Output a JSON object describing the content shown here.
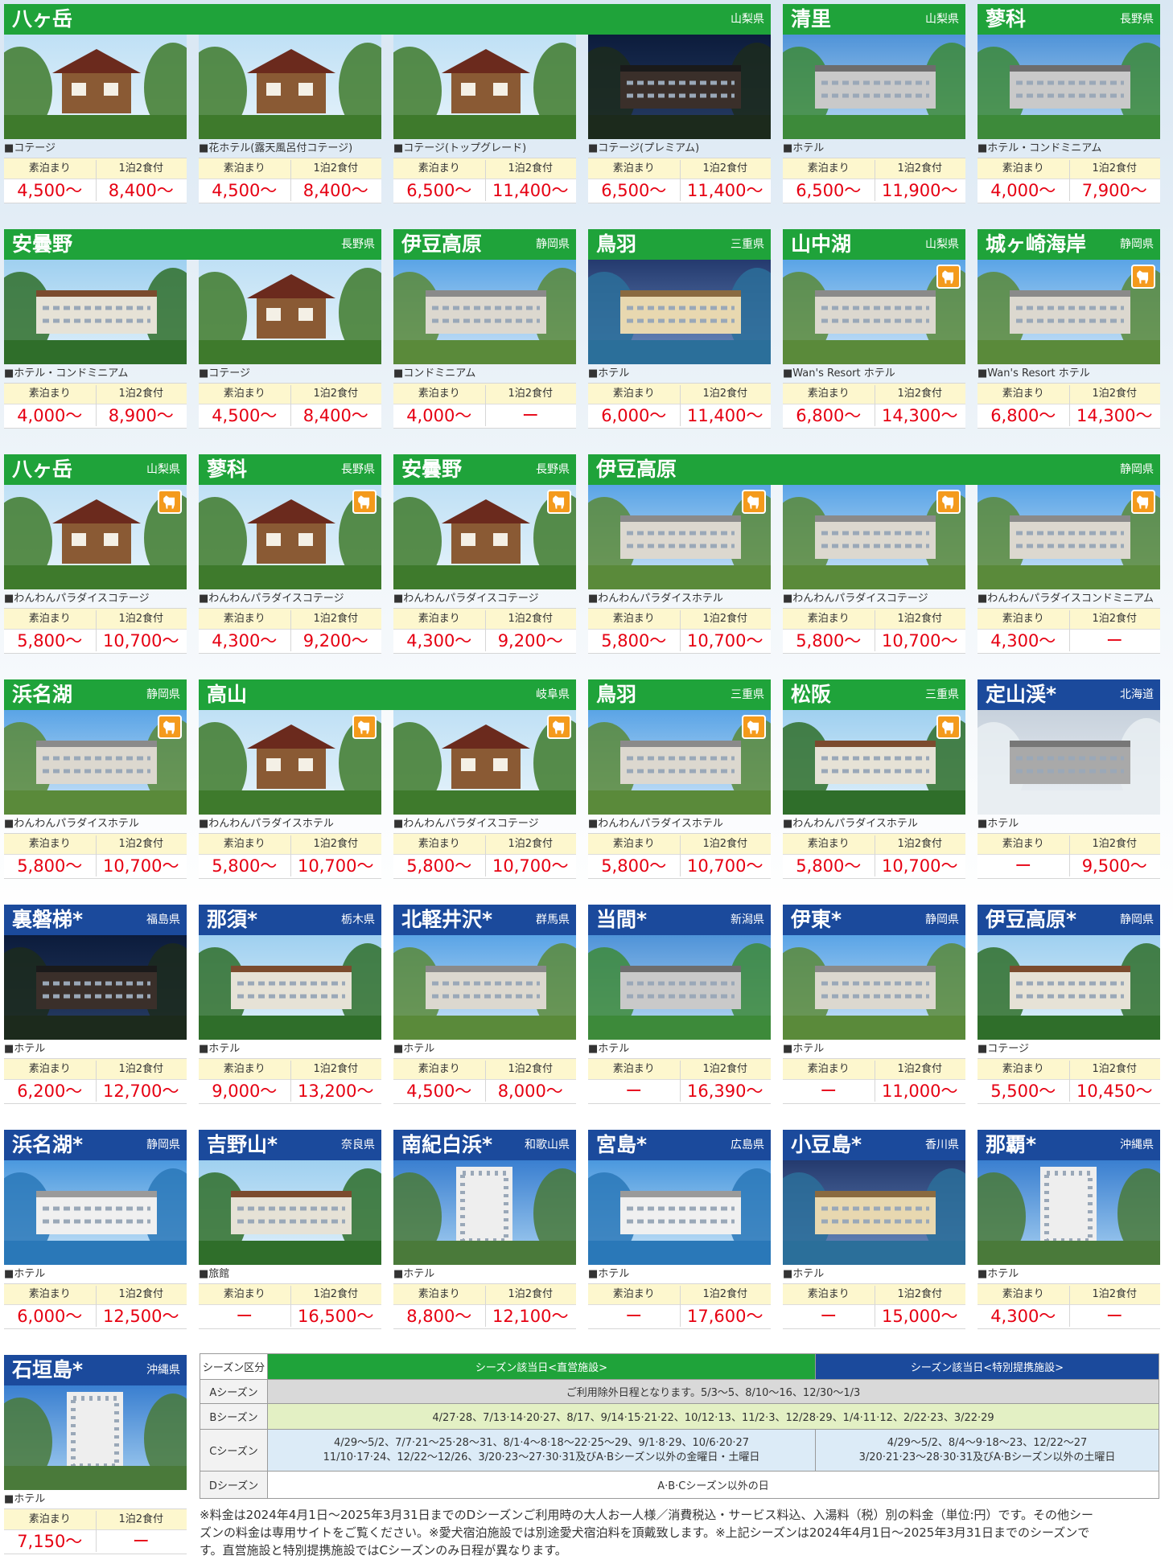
{
  "grid": {
    "price_labels": [
      "素泊まり",
      "1泊2食付"
    ],
    "rows": [
      {
        "headers": [
          {
            "name": "八ヶ岳",
            "pref": "山梨県",
            "span": 4,
            "color": "green"
          },
          {
            "name": "清里",
            "pref": "山梨県",
            "span": 1,
            "color": "green"
          },
          {
            "name": "蓼科",
            "pref": "長野県",
            "span": 1,
            "color": "green"
          }
        ],
        "cards": [
          {
            "type": "■コテージ",
            "stay": "4,500～",
            "meal": "8,400～",
            "dog": false,
            "scene": "cabin"
          },
          {
            "type": "■花ホテル(露天風呂付コテージ)",
            "stay": "4,500～",
            "meal": "8,400～",
            "dog": false,
            "scene": "cabin"
          },
          {
            "type": "■コテージ(トップグレード)",
            "stay": "6,500～",
            "meal": "11,400～",
            "dog": false,
            "scene": "cabin"
          },
          {
            "type": "■コテージ(プレミアム)",
            "stay": "6,500～",
            "meal": "11,400～",
            "dog": false,
            "scene": "night"
          },
          {
            "type": "■ホテル",
            "stay": "6,500～",
            "meal": "11,900～",
            "dog": false,
            "scene": "lake"
          },
          {
            "type": "■ホテル・コンドミニアム",
            "stay": "4,000～",
            "meal": "7,900～",
            "dog": false,
            "scene": "lake"
          }
        ]
      },
      {
        "headers": [
          {
            "name": "安曇野",
            "pref": "長野県",
            "span": 2,
            "color": "green"
          },
          {
            "name": "伊豆高原",
            "pref": "静岡県",
            "span": 1,
            "color": "green"
          },
          {
            "name": "鳥羽",
            "pref": "三重県",
            "span": 1,
            "color": "green"
          },
          {
            "name": "山中湖",
            "pref": "山梨県",
            "span": 1,
            "color": "green"
          },
          {
            "name": "城ヶ崎海岸",
            "pref": "静岡県",
            "span": 1,
            "color": "green"
          }
        ],
        "cards": [
          {
            "type": "■ホテル・コンドミニアム",
            "stay": "4,000～",
            "meal": "8,900～",
            "dog": false,
            "scene": "forest"
          },
          {
            "type": "■コテージ",
            "stay": "4,500～",
            "meal": "8,400～",
            "dog": false,
            "scene": "cabin"
          },
          {
            "type": "■コンドミニアム",
            "stay": "4,000～",
            "meal": "ー",
            "dog": false,
            "scene": "building"
          },
          {
            "type": "■ホテル",
            "stay": "6,000～",
            "meal": "11,400～",
            "dog": false,
            "scene": "pool"
          },
          {
            "type": "■Wan's Resort ホテル",
            "stay": "6,800～",
            "meal": "14,300～",
            "dog": true,
            "scene": "building"
          },
          {
            "type": "■Wan's Resort ホテル",
            "stay": "6,800～",
            "meal": "14,300～",
            "dog": true,
            "scene": "building"
          }
        ]
      },
      {
        "headers": [
          {
            "name": "八ヶ岳",
            "pref": "山梨県",
            "span": 1,
            "color": "green"
          },
          {
            "name": "蓼科",
            "pref": "長野県",
            "span": 1,
            "color": "green"
          },
          {
            "name": "安曇野",
            "pref": "長野県",
            "span": 1,
            "color": "green"
          },
          {
            "name": "伊豆高原",
            "pref": "静岡県",
            "span": 3,
            "color": "green"
          }
        ],
        "cards": [
          {
            "type": "■わんわんパラダイスコテージ",
            "stay": "5,800～",
            "meal": "10,700～",
            "dog": true,
            "scene": "cabin"
          },
          {
            "type": "■わんわんパラダイスコテージ",
            "stay": "4,300～",
            "meal": "9,200～",
            "dog": true,
            "scene": "cabin"
          },
          {
            "type": "■わんわんパラダイスコテージ",
            "stay": "4,300～",
            "meal": "9,200～",
            "dog": true,
            "scene": "cabin"
          },
          {
            "type": "■わんわんパラダイスホテル",
            "stay": "5,800～",
            "meal": "10,700～",
            "dog": true,
            "scene": "building"
          },
          {
            "type": "■わんわんパラダイスコテージ",
            "stay": "5,800～",
            "meal": "10,700～",
            "dog": true,
            "scene": "building"
          },
          {
            "type": "■わんわんパラダイスコンドミニアム",
            "stay": "4,300～",
            "meal": "ー",
            "dog": true,
            "scene": "building"
          }
        ]
      },
      {
        "headers": [
          {
            "name": "浜名湖",
            "pref": "静岡県",
            "span": 1,
            "color": "green"
          },
          {
            "name": "高山",
            "pref": "岐阜県",
            "span": 2,
            "color": "green"
          },
          {
            "name": "鳥羽",
            "pref": "三重県",
            "span": 1,
            "color": "green"
          },
          {
            "name": "松阪",
            "pref": "三重県",
            "span": 1,
            "color": "green"
          },
          {
            "name": "定山渓*",
            "pref": "北海道",
            "span": 1,
            "color": "blue"
          }
        ],
        "cards": [
          {
            "type": "■わんわんパラダイスホテル",
            "stay": "5,800～",
            "meal": "10,700～",
            "dog": true,
            "scene": "building"
          },
          {
            "type": "■わんわんパラダイスホテル",
            "stay": "5,800～",
            "meal": "10,700～",
            "dog": true,
            "scene": "cabin"
          },
          {
            "type": "■わんわんパラダイスコテージ",
            "stay": "5,800～",
            "meal": "10,700～",
            "dog": true,
            "scene": "cabin"
          },
          {
            "type": "■わんわんパラダイスホテル",
            "stay": "5,800～",
            "meal": "10,700～",
            "dog": true,
            "scene": "building"
          },
          {
            "type": "■わんわんパラダイスホテル",
            "stay": "5,800～",
            "meal": "10,700～",
            "dog": true,
            "scene": "forest"
          },
          {
            "type": "■ホテル",
            "stay": "ー",
            "meal": "9,500～",
            "dog": false,
            "scene": "snow"
          }
        ]
      },
      {
        "headers": [
          {
            "name": "裏磐梯*",
            "pref": "福島県",
            "span": 1,
            "color": "blue"
          },
          {
            "name": "那須*",
            "pref": "栃木県",
            "span": 1,
            "color": "blue"
          },
          {
            "name": "北軽井沢*",
            "pref": "群馬県",
            "span": 1,
            "color": "blue"
          },
          {
            "name": "当間*",
            "pref": "新潟県",
            "span": 1,
            "color": "blue"
          },
          {
            "name": "伊東*",
            "pref": "静岡県",
            "span": 1,
            "color": "blue"
          },
          {
            "name": "伊豆高原*",
            "pref": "静岡県",
            "span": 1,
            "color": "blue"
          }
        ],
        "cards": [
          {
            "type": "■ホテル",
            "stay": "6,200～",
            "meal": "12,700～",
            "dog": false,
            "scene": "night"
          },
          {
            "type": "■ホテル",
            "stay": "9,000～",
            "meal": "13,200～",
            "dog": false,
            "scene": "forest"
          },
          {
            "type": "■ホテル",
            "stay": "4,500～",
            "meal": "8,000～",
            "dog": false,
            "scene": "building"
          },
          {
            "type": "■ホテル",
            "stay": "ー",
            "meal": "16,390～",
            "dog": false,
            "scene": "lake"
          },
          {
            "type": "■ホテル",
            "stay": "ー",
            "meal": "11,000～",
            "dog": false,
            "scene": "building"
          },
          {
            "type": "■コテージ",
            "stay": "5,500～",
            "meal": "10,450～",
            "dog": false,
            "scene": "forest"
          }
        ]
      },
      {
        "headers": [
          {
            "name": "浜名湖*",
            "pref": "静岡県",
            "span": 1,
            "color": "blue"
          },
          {
            "name": "吉野山*",
            "pref": "奈良県",
            "span": 1,
            "color": "blue"
          },
          {
            "name": "南紀白浜*",
            "pref": "和歌山県",
            "span": 1,
            "color": "blue"
          },
          {
            "name": "宮島*",
            "pref": "広島県",
            "span": 1,
            "color": "blue"
          },
          {
            "name": "小豆島*",
            "pref": "香川県",
            "span": 1,
            "color": "blue"
          },
          {
            "name": "那覇*",
            "pref": "沖縄県",
            "span": 1,
            "color": "blue"
          }
        ],
        "cards": [
          {
            "type": "■ホテル",
            "stay": "6,000～",
            "meal": "12,500～",
            "dog": false,
            "scene": "sea"
          },
          {
            "type": "■旅館",
            "stay": "ー",
            "meal": "16,500～",
            "dog": false,
            "scene": "forest"
          },
          {
            "type": "■ホテル",
            "stay": "8,800～",
            "meal": "12,100～",
            "dog": false,
            "scene": "tower"
          },
          {
            "type": "■ホテル",
            "stay": "ー",
            "meal": "17,600～",
            "dog": false,
            "scene": "sea"
          },
          {
            "type": "■ホテル",
            "stay": "ー",
            "meal": "15,000～",
            "dog": false,
            "scene": "pool"
          },
          {
            "type": "■ホテル",
            "stay": "4,300～",
            "meal": "ー",
            "dog": false,
            "scene": "tower"
          }
        ]
      }
    ],
    "last": {
      "name": "石垣島*",
      "pref": "沖縄県",
      "type": "■ホテル",
      "stay": "7,150～",
      "meal": "ー",
      "scene": "tower",
      "color": "blue"
    }
  },
  "season_table": {
    "corner": "シーズン区分",
    "direct_header": "シーズン該当日<直営施設>",
    "partner_header": "シーズン該当日<特別提携施設>",
    "a": {
      "label": "Aシーズン",
      "text": "ご利用除外日程となります。5/3～5、8/10～16、12/30～1/3"
    },
    "b": {
      "label": "Bシーズン",
      "text": "4/27·28、7/13·14·20·27、8/17、9/14·15·21·22、10/12·13、11/2·3、12/28·29、1/4·11·12、2/22·23、3/22·29"
    },
    "c": {
      "label": "Cシーズン",
      "direct_1": "4/29～5/2、7/7·21～25·28～31、8/1·4～8·18～22·25～29、9/1·8·29、10/6·20·27",
      "direct_2": "11/10·17·24、12/22～12/26、3/20·23～27·30·31及びA·Bシーズン以外の金曜日・土曜日",
      "partner_1": "4/29～5/2、8/4～9·18～23、12/22～27",
      "partner_2": "3/20·21·23～28·30·31及びA·Bシーズン以外の土曜日"
    },
    "d": {
      "label": "Dシーズン",
      "text": "A·B·Cシーズン以外の日"
    }
  },
  "notes": {
    "line1": "※料金は2024年4月1日～2025年3月31日までのDシーズンご利用時の大人お一人様／消費税込・サービス料込、入湯料（税）別の料金（単位:円）です。その他シー",
    "line2": "ズンの料金は専用サイトをご覧ください。※愛犬宿泊施設では別途愛犬宿泊料を頂戴致します。※上記シーズンは2024年4月1日～2025年3月31日までのシーズンで",
    "line3": "す。直営施設と特別提携施設ではCシーズンのみ日程が異なります。"
  },
  "colors": {
    "green": "#1fa33a",
    "blue": "#1b4a9c",
    "price": "#e60012",
    "label_bg": "#fdf7ce",
    "dog_badge": "#f49a1c"
  }
}
